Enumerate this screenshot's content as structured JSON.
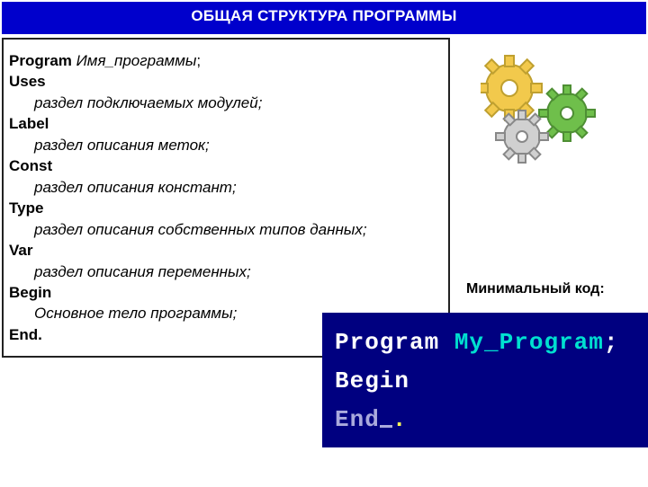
{
  "title": "ОБЩАЯ СТРУКТУРА ПРОГРАММЫ",
  "code": {
    "program_kw": "Program",
    "program_name": " Имя_программы",
    "program_semi": ";",
    "uses_kw": "Uses",
    "uses_body": "раздел подключаемых модулей;",
    "label_kw": "Label",
    "label_body": "раздел описания меток;",
    "const_kw": "Const",
    "const_body": "раздел описания констант;",
    "type_kw": "Type",
    "type_body": "раздел описания собственных типов данных;",
    "var_kw": "Var",
    "var_body": "раздел описания переменных;",
    "begin_kw": "Begin",
    "begin_body": "Основное тело программы;",
    "end_kw": "End."
  },
  "right": {
    "minimal_label": "Минимальный код:"
  },
  "terminal": {
    "prog_kw": "Program ",
    "prog_name": "My_Program",
    "semi": ";",
    "begin": "Begin",
    "end": "End",
    "dot": "."
  }
}
